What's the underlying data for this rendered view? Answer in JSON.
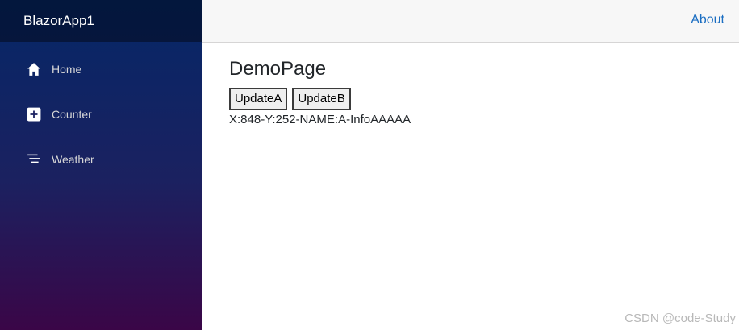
{
  "app": {
    "brand": "BlazorApp1"
  },
  "sidebar": {
    "items": [
      {
        "label": "Home",
        "icon": "house-icon"
      },
      {
        "label": "Counter",
        "icon": "plus-square-icon"
      },
      {
        "label": "Weather",
        "icon": "list-icon"
      }
    ]
  },
  "header": {
    "about_label": "About"
  },
  "main": {
    "title": "DemoPage",
    "buttons": {
      "update_a": "UpdateA",
      "update_b": "UpdateB"
    },
    "info_text": "X:848-Y:252-NAME:A-InfoAAAAA"
  },
  "watermark": "CSDN @code-Study",
  "colors": {
    "link": "#1b6ec2",
    "sidebar_top": "#052767",
    "sidebar_bottom": "#3a0647"
  }
}
